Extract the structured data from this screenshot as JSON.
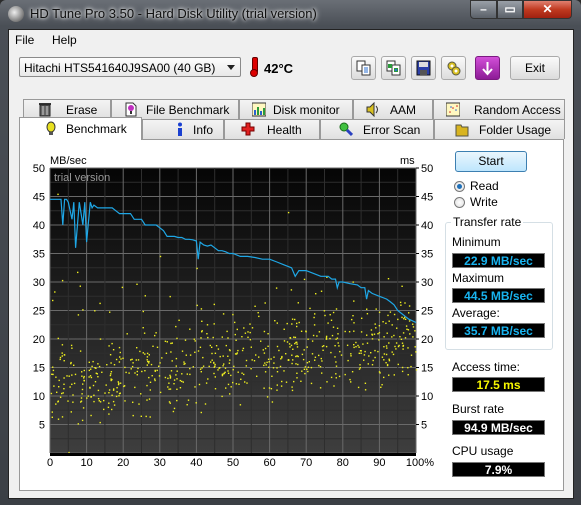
{
  "window": {
    "title": "HD Tune Pro 3.50 - Hard Disk Utility (trial version)",
    "controls": [
      "minimize",
      "maximize",
      "close"
    ]
  },
  "menu": [
    {
      "label": "File"
    },
    {
      "label": "Help"
    }
  ],
  "toolbar": {
    "drive": "Hitachi HTS541640J9SA00 (40 GB)",
    "temperature": "42°C",
    "buttons": [
      {
        "name": "copy-text-icon"
      },
      {
        "name": "copy-screenshot-icon"
      },
      {
        "name": "save-icon"
      },
      {
        "name": "options-icon"
      },
      {
        "name": "download-icon"
      }
    ],
    "exit_label": "Exit"
  },
  "tabs_row1": [
    {
      "label": "Erase",
      "icon": "trash-icon"
    },
    {
      "label": "File Benchmark",
      "icon": "file-benchmark-icon"
    },
    {
      "label": "Disk monitor",
      "icon": "disk-monitor-icon"
    },
    {
      "label": "AAM",
      "icon": "speaker-icon"
    },
    {
      "label": "Random Access",
      "icon": "random-access-icon"
    }
  ],
  "tabs_row2": [
    {
      "label": "Benchmark",
      "icon": "lightbulb-icon",
      "active": true
    },
    {
      "label": "Info",
      "icon": "info-icon"
    },
    {
      "label": "Health",
      "icon": "health-cross-icon"
    },
    {
      "label": "Error Scan",
      "icon": "magnifier-icon"
    },
    {
      "label": "Folder Usage",
      "icon": "folder-icon"
    }
  ],
  "side": {
    "start_label": "Start",
    "read_label": "Read",
    "write_label": "Write",
    "mode_selected": "Read",
    "transfer_rate_label": "Transfer rate",
    "minimum_label": "Minimum",
    "minimum_value": "22.9 MB/sec",
    "maximum_label": "Maximum",
    "maximum_value": "44.5 MB/sec",
    "average_label": "Average:",
    "average_value": "35.7 MB/sec",
    "access_time_label": "Access time:",
    "access_time_value": "17.5 ms",
    "burst_rate_label": "Burst rate",
    "burst_rate_value": "94.9 MB/sec",
    "cpu_usage_label": "CPU usage",
    "cpu_usage_value": "7.9%"
  },
  "colors": {
    "transfer_line": "#1fa7e6",
    "access_points": "#f0f020",
    "lcd_blue": "#18b4f0",
    "lcd_yellow": "#f7f700",
    "lcd_white": "#ffffff"
  },
  "chart_data": {
    "type": "line",
    "title": "",
    "watermark": "trial version",
    "ylabel_left": "MB/sec",
    "ylabel_right": "ms",
    "xlabel": "",
    "xlim": [
      0,
      100
    ],
    "ylim": [
      0,
      50
    ],
    "ylim_right": [
      0,
      50
    ],
    "x_ticks": [
      "0",
      "10",
      "20",
      "30",
      "40",
      "50",
      "60",
      "70",
      "80",
      "90",
      "100%"
    ],
    "y_ticks": [
      "5",
      "10",
      "15",
      "20",
      "25",
      "30",
      "35",
      "40",
      "45",
      "50"
    ],
    "y_ticks_right": [
      "5",
      "10",
      "15",
      "20",
      "25",
      "30",
      "35",
      "40",
      "45",
      "50"
    ],
    "grid": true,
    "series": [
      {
        "name": "Transfer rate",
        "axis": "left",
        "x": [
          0,
          2,
          3,
          3.5,
          4,
          4.5,
          5,
          6,
          6.5,
          7,
          8,
          8.5,
          9,
          9.5,
          10,
          11,
          11.5,
          12,
          13,
          14,
          15,
          16,
          17,
          18,
          19,
          20,
          22,
          23,
          24,
          25,
          26,
          27,
          28,
          29,
          30,
          31,
          32,
          33,
          34,
          35,
          36,
          37,
          38,
          39,
          40,
          40.5,
          41,
          42,
          43,
          44,
          45,
          46,
          47,
          48,
          49,
          50,
          52,
          54,
          56,
          58,
          60,
          62,
          64,
          66,
          67,
          68,
          69,
          70,
          72,
          74,
          76,
          77,
          78,
          78.5,
          79,
          80,
          82,
          84,
          85,
          86,
          86.5,
          87,
          88,
          90,
          92,
          93,
          94,
          95,
          96,
          97,
          98,
          100
        ],
        "values": [
          44.5,
          44.5,
          44.5,
          40,
          44.5,
          44.5,
          44,
          41,
          44,
          36,
          44,
          42,
          40,
          44,
          37,
          44,
          43,
          43.5,
          43,
          43,
          43,
          43,
          43,
          42.5,
          42,
          42,
          42,
          41,
          41,
          41,
          40,
          40,
          40,
          40,
          39.5,
          39,
          38,
          38,
          38,
          37.8,
          37.8,
          37.5,
          37.5,
          37.4,
          37.2,
          34,
          37,
          36.5,
          36.3,
          36.5,
          36,
          35.5,
          35.5,
          35.3,
          35,
          35,
          34.5,
          34.5,
          34.3,
          34,
          34,
          33.5,
          33,
          32.5,
          31,
          32,
          32,
          32,
          31.5,
          31,
          31,
          30.5,
          30.5,
          29,
          30,
          30,
          29.7,
          29.5,
          29,
          29,
          27,
          28.5,
          28,
          27.5,
          27,
          26.5,
          26,
          25,
          24.5,
          24,
          23.5,
          22.9
        ]
      },
      {
        "name": "Access time",
        "axis": "right",
        "type": "scatter",
        "description": "Yellow scatter points, dense between 5 and 25 ms, mean 17.5 ms, with a few outliers up to ~46 ms",
        "range_ms": [
          5,
          46
        ],
        "mean_ms": 17.5
      }
    ]
  }
}
